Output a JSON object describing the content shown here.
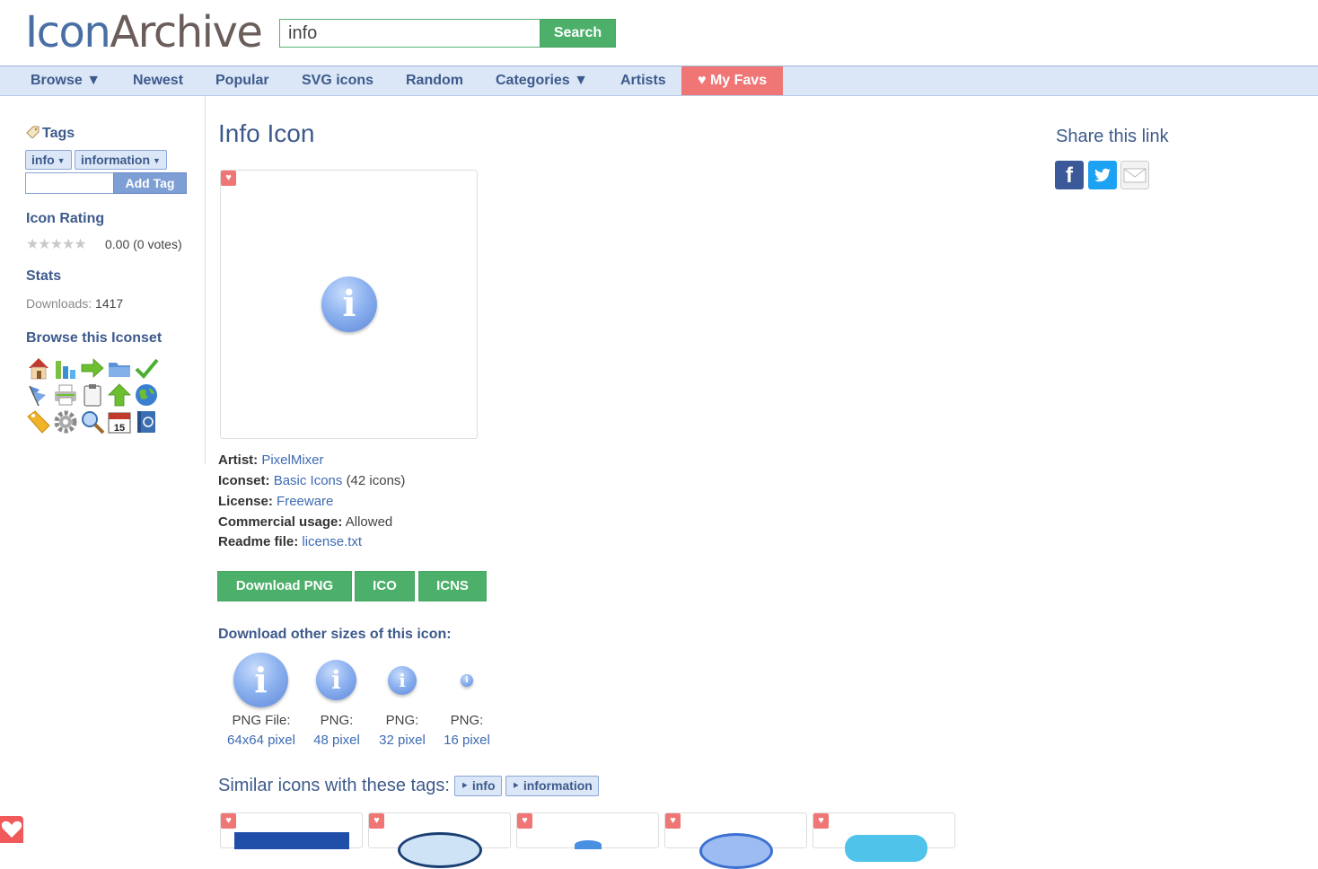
{
  "header": {
    "logo_part1": "Icon",
    "logo_part2": "Archive",
    "search_value": "info",
    "search_button": "Search"
  },
  "nav": {
    "items": [
      "Browse ▼",
      "Newest",
      "Popular",
      "SVG icons",
      "Random",
      "Categories ▼",
      "Artists"
    ],
    "favs": "♥ My Favs"
  },
  "sidebar": {
    "tags_heading": "Tags",
    "tags": [
      "info",
      "information"
    ],
    "add_tag_button": "Add Tag",
    "rating_heading": "Icon Rating",
    "stars": "★★★★★",
    "rating_text": "0.00 (0 votes)",
    "stats_heading": "Stats",
    "downloads_label": "Downloads:",
    "downloads_value": "1417",
    "browse_heading": "Browse this Iconset",
    "calendar_day": "15"
  },
  "main": {
    "title": "Info Icon",
    "fav_glyph": "♥",
    "info_glyph": "i",
    "meta": {
      "artist_label": "Artist:",
      "artist_value": "PixelMixer",
      "iconset_label": "Iconset:",
      "iconset_value": "Basic Icons",
      "iconset_count": "(42 icons)",
      "license_label": "License:",
      "license_value": "Freeware",
      "commercial_label": "Commercial usage:",
      "commercial_value": "Allowed",
      "readme_label": "Readme file:",
      "readme_value": "license.txt"
    },
    "download_buttons": [
      "Download PNG",
      "ICO",
      "ICNS"
    ],
    "other_sizes_heading": "Download other sizes of this icon:",
    "sizes": [
      {
        "label": "PNG File:",
        "link": "64x64 pixel"
      },
      {
        "label": "PNG:",
        "link": "48 pixel"
      },
      {
        "label": "PNG:",
        "link": "32 pixel"
      },
      {
        "label": "PNG:",
        "link": "16 pixel"
      }
    ],
    "similar_heading": "Similar icons with these tags:",
    "similar_tags": [
      "‣ info",
      "‣ information"
    ]
  },
  "share": {
    "title": "Share this link",
    "facebook_glyph": "f"
  },
  "colors": {
    "brand_blue": "#3d5a8c",
    "nav_bg": "#dbe7f7",
    "green_button": "#4caf6a",
    "fav_red": "#f07676"
  }
}
